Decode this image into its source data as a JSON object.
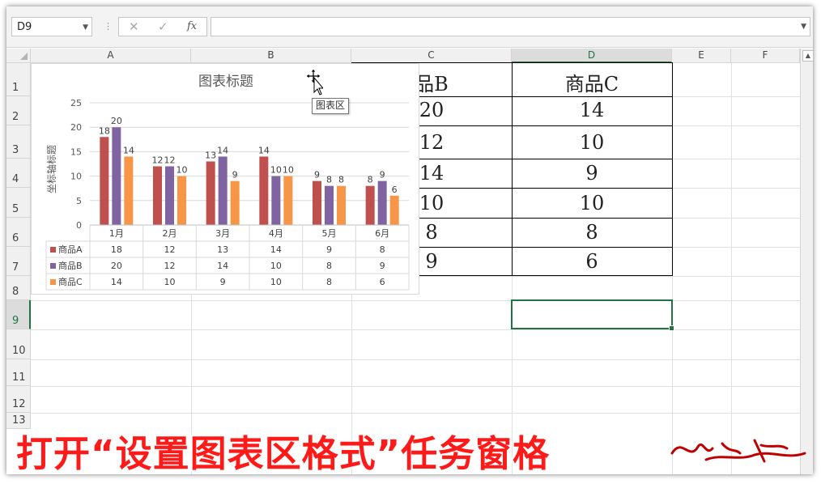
{
  "formula_bar": {
    "name_box": "D9",
    "cancel_icon": "✕",
    "enter_icon": "✓",
    "fx_label": "fx",
    "formula": ""
  },
  "columns": [
    "A",
    "B",
    "C",
    "D",
    "E",
    "F"
  ],
  "selected_column": "D",
  "rows": [
    "1",
    "2",
    "3",
    "4",
    "5",
    "6",
    "7",
    "8",
    "9",
    "10",
    "11",
    "12",
    "13"
  ],
  "selected_row": "9",
  "visible_cells": {
    "c_header": "品B",
    "c_values": [
      "20",
      "12",
      "14",
      "10",
      "8",
      "9"
    ],
    "d_header": "商品C",
    "d_values": [
      "14",
      "10",
      "9",
      "10",
      "8",
      "6"
    ]
  },
  "tooltip": "图表区",
  "banner_text": "打开“设置图表区格式”任务窗格",
  "chart_data": {
    "type": "bar",
    "title": "图表标题",
    "ylabel": "坐标轴标题",
    "ylim": [
      0,
      25
    ],
    "yticks": [
      "0",
      "5",
      "10",
      "15",
      "20",
      "25"
    ],
    "categories": [
      "1月",
      "2月",
      "3月",
      "4月",
      "5月",
      "6月"
    ],
    "series": [
      {
        "name": "商品A",
        "color": "#c0504d",
        "values": [
          18,
          12,
          13,
          14,
          9,
          8
        ]
      },
      {
        "name": "商品B",
        "color": "#8064a2",
        "values": [
          20,
          12,
          14,
          10,
          8,
          9
        ]
      },
      {
        "name": "商品C",
        "color": "#f79646",
        "values": [
          14,
          10,
          9,
          10,
          8,
          6
        ]
      }
    ],
    "data_table": true,
    "grid": true
  }
}
